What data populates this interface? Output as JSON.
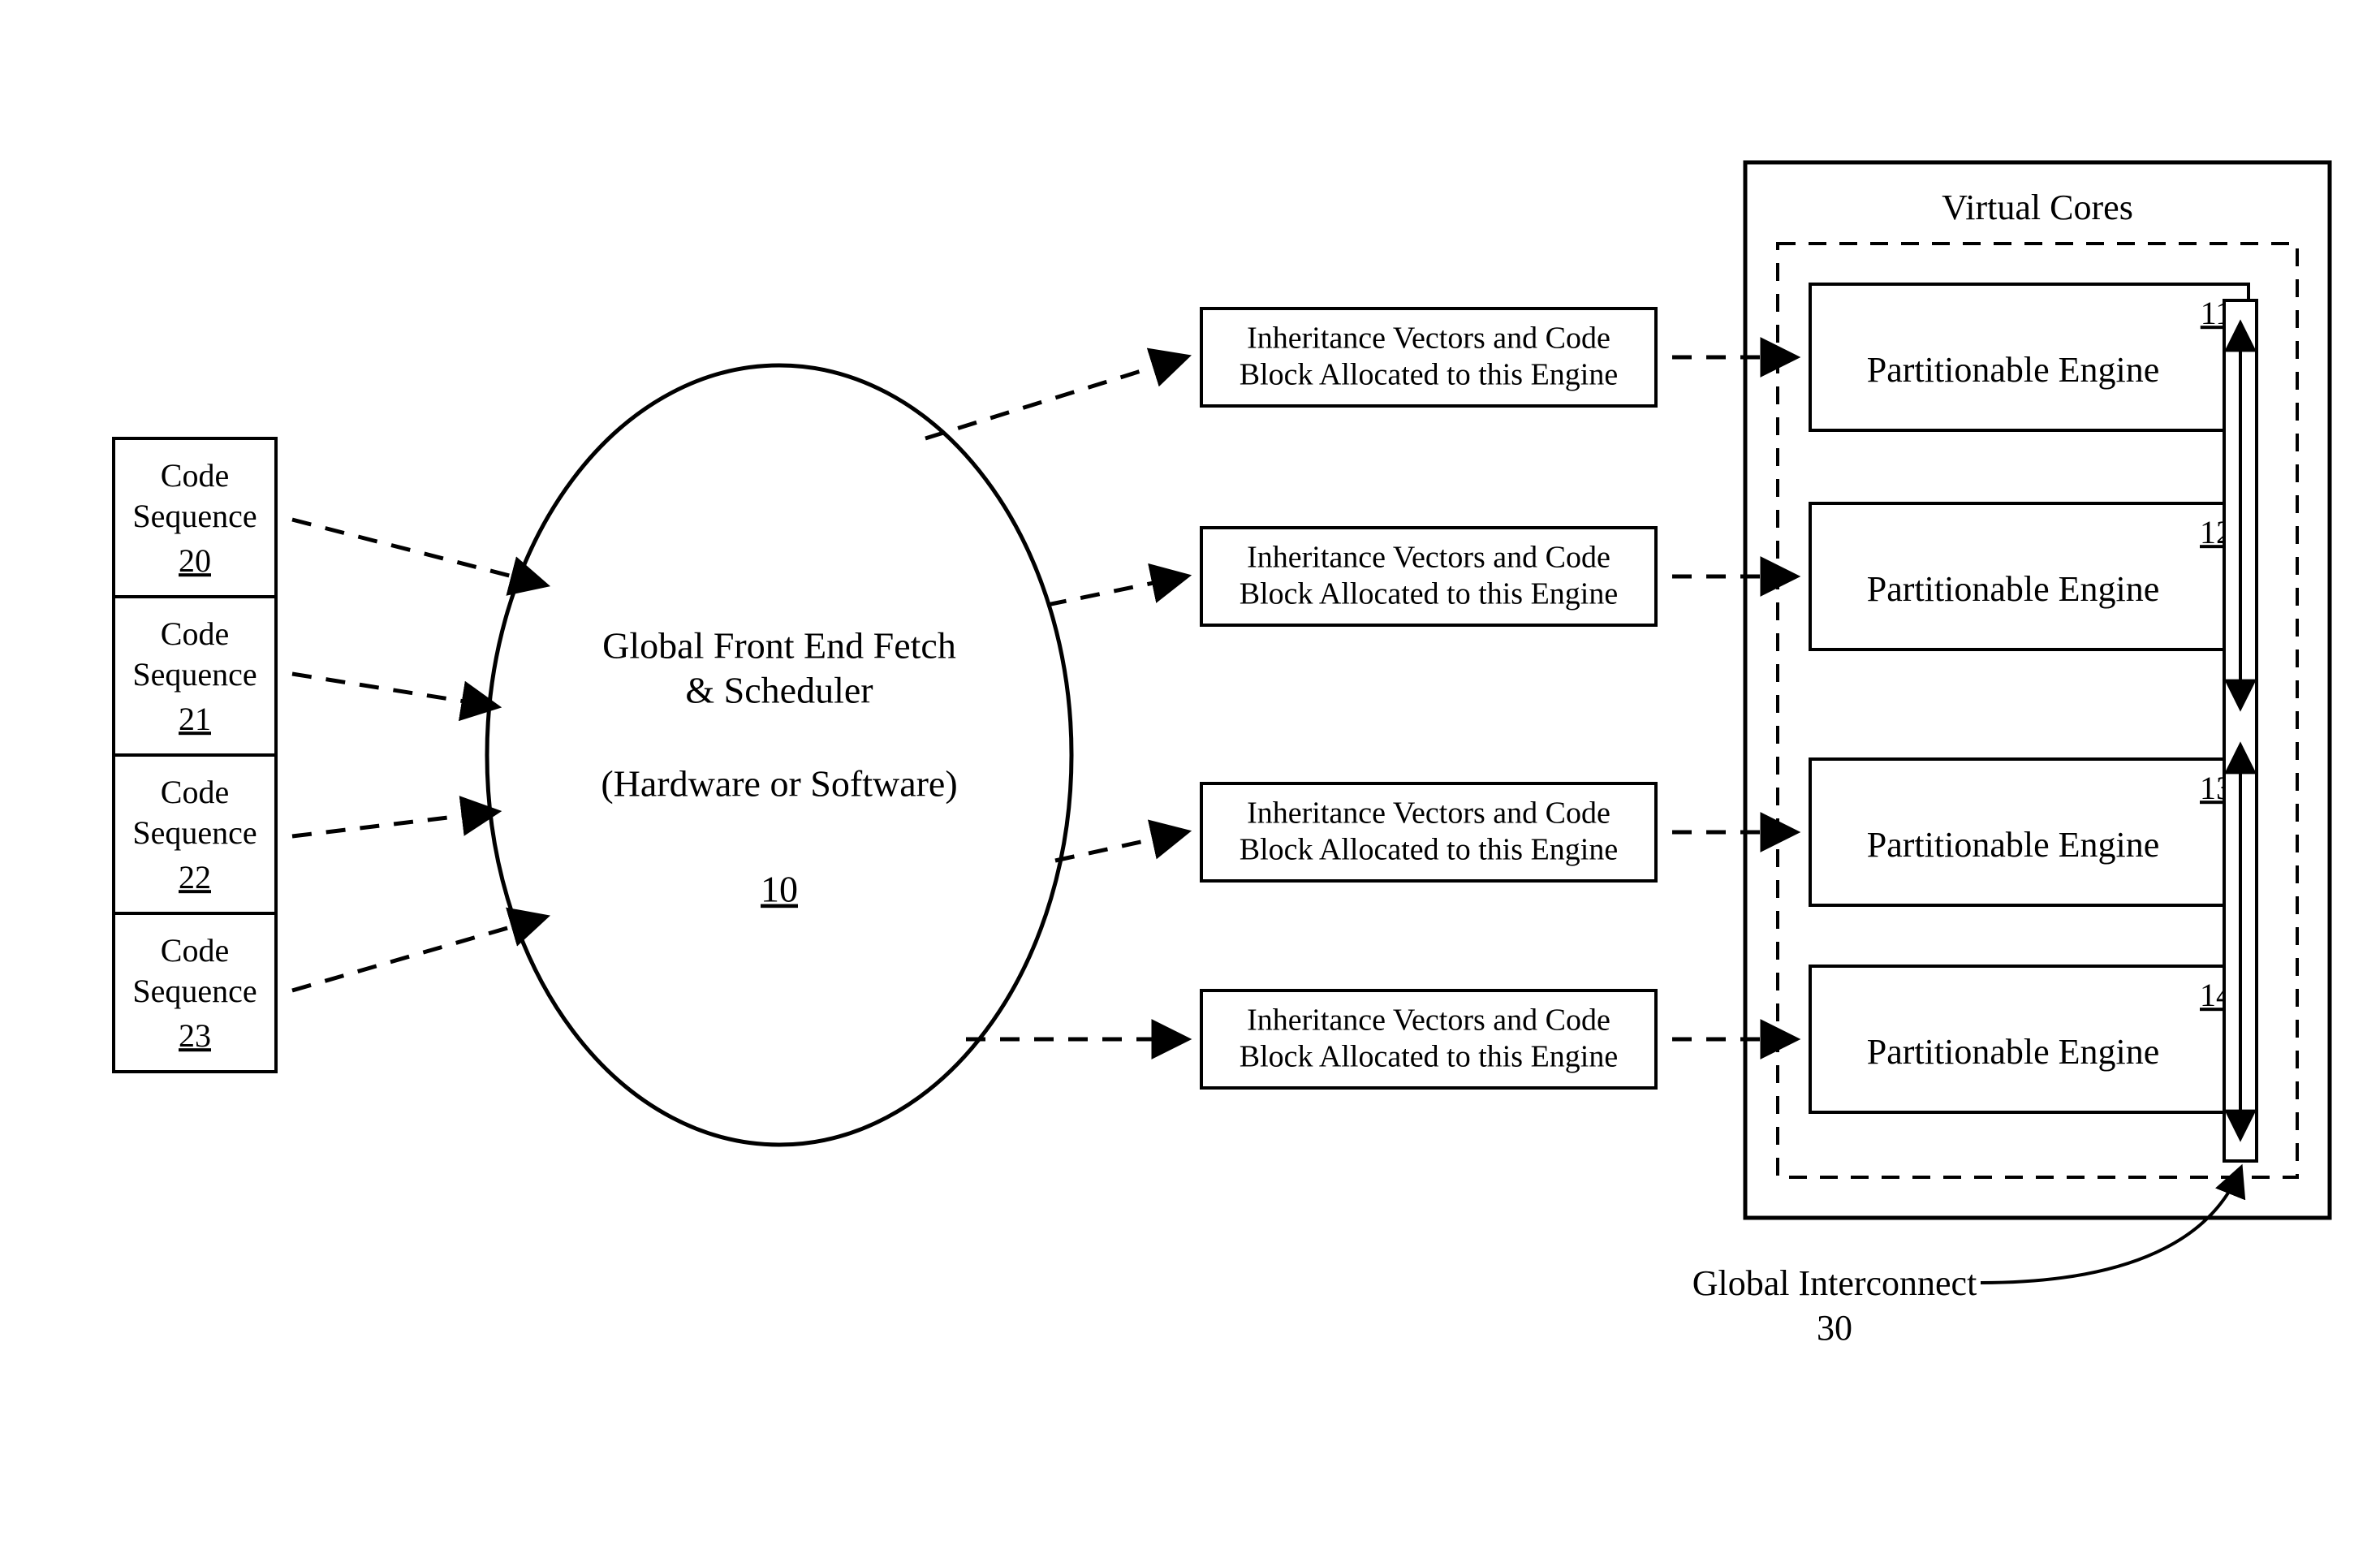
{
  "codeSequences": [
    {
      "line1": "Code",
      "line2": "Sequence",
      "ref": "20"
    },
    {
      "line1": "Code",
      "line2": "Sequence",
      "ref": "21"
    },
    {
      "line1": "Code",
      "line2": "Sequence",
      "ref": "22"
    },
    {
      "line1": "Code",
      "line2": "Sequence",
      "ref": "23"
    }
  ],
  "scheduler": {
    "line1": "Global Front End Fetch",
    "line2": "& Scheduler",
    "line3": "(Hardware or Software)",
    "ref": "10"
  },
  "inheritance": {
    "line1": "Inheritance Vectors and Code",
    "line2": "Block Allocated to this Engine"
  },
  "virtualCoresTitle": "Virtual Cores",
  "engines": [
    {
      "label": "Partitionable Engine",
      "ref": "11"
    },
    {
      "label": "Partitionable Engine",
      "ref": "12"
    },
    {
      "label": "Partitionable Engine",
      "ref": "13"
    },
    {
      "label": "Partitionable Engine",
      "ref": "14"
    }
  ],
  "interconnect": {
    "label": "Global Interconnect",
    "ref": "30"
  }
}
